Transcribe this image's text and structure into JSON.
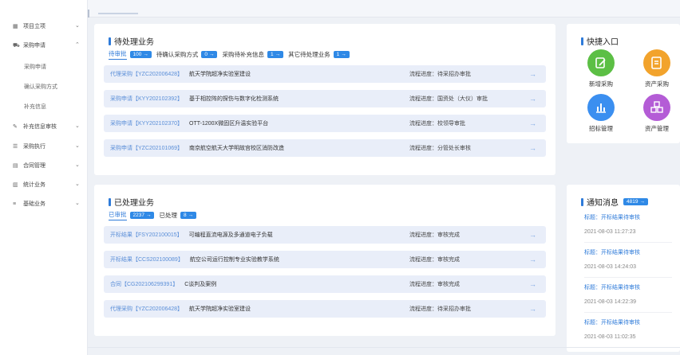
{
  "sidebar": {
    "items": [
      {
        "label": "项目立项",
        "icon": "grid-icon",
        "glyph": "▦",
        "expanded": false
      },
      {
        "label": "采购申请",
        "icon": "cart-icon",
        "glyph": "⛟",
        "expanded": true
      },
      {
        "label": "补充信息审核",
        "icon": "edit-icon",
        "glyph": "✎",
        "expanded": false
      },
      {
        "label": "采购执行",
        "icon": "list-icon",
        "glyph": "☰",
        "expanded": false
      },
      {
        "label": "合同管理",
        "icon": "document-icon",
        "glyph": "▤",
        "expanded": false
      },
      {
        "label": "统计业务",
        "icon": "chart-icon",
        "glyph": "▥",
        "expanded": false
      },
      {
        "label": "基础业务",
        "icon": "stack-icon",
        "glyph": "≡",
        "expanded": false
      }
    ],
    "submenu": [
      "采购申请",
      "确认采购方式",
      "补充信息"
    ]
  },
  "pending": {
    "title": "待处理业务",
    "tabs": [
      {
        "label": "待审批",
        "count": "100"
      },
      {
        "label": "待确认采购方式",
        "count": "0"
      },
      {
        "label": "采购待补充信息",
        "count": "1"
      },
      {
        "label": "其它待处理业务",
        "count": "1"
      }
    ],
    "rows": [
      {
        "code": "代理采购【YZC202006428】",
        "name": "航天学院超净实验室建设",
        "status": "流程进度：待采招办审批"
      },
      {
        "code": "采购申请【KYY202102392】",
        "name": "基于相控阵的探伤与数字化检测系统",
        "status": "流程进度：国资处（大仪）审批"
      },
      {
        "code": "采购申请【KYY202102370】",
        "name": "OTT-1200X微固区升温实验平台",
        "status": "流程进度：校领导审批"
      },
      {
        "code": "采购申请【YZC202101069】",
        "name": "南京航空航天大学明故宫校区消防改造",
        "status": "流程进度：分管处长审核"
      }
    ]
  },
  "done": {
    "title": "已处理业务",
    "tabs": [
      {
        "label": "已审批",
        "count": "2237"
      },
      {
        "label": "已处理",
        "count": "8"
      }
    ],
    "rows": [
      {
        "code": "开标结果【FSY202100015】",
        "name": "可编程直流电源及多通道电子负载",
        "status": "流程进度：审核完成"
      },
      {
        "code": "开标结果【CCS202100089】",
        "name": "航空公司运行控制专业实验教学系统",
        "status": "流程进度：审核完成"
      },
      {
        "code": "合同【CG202106299391】",
        "name": "C谈判及案例",
        "status": "流程进度：审核完成"
      },
      {
        "code": "代理采购【YZC202006428】",
        "name": "航天学院超净实验室建设",
        "status": "流程进度：待采招办审批"
      }
    ]
  },
  "quick": {
    "title": "快捷入口",
    "items": [
      {
        "label": "新增采购",
        "icon": "new-purchase-icon",
        "color": "#5cbf45",
        "glyph": "✎"
      },
      {
        "label": "资产采购",
        "icon": "asset-purchase-icon",
        "color": "#f2a32c",
        "glyph": "✎"
      },
      {
        "label": "招标管理",
        "icon": "tender-chart-icon",
        "color": "#3b8ff0",
        "glyph": "▮"
      },
      {
        "label": "资产管理",
        "icon": "asset-cubes-icon",
        "color": "#b45cd6",
        "glyph": "◈"
      }
    ]
  },
  "notices": {
    "title": "通知消息",
    "count": "4819",
    "items": [
      {
        "title": "标题：开标结果待审核",
        "date": "2021-08-03 11:27:23"
      },
      {
        "title": "标题：开标结果待审核",
        "date": "2021-08-03 14:24:03"
      },
      {
        "title": "标题：开标结果待审核",
        "date": "2021-08-03 14:22:39"
      },
      {
        "title": "标题：开标结果待审核",
        "date": "2021-08-03 11:02:35"
      }
    ]
  },
  "colors": {
    "accent": "#2f7bd9",
    "badge": "#2f89e6",
    "row_bg": "#e9eef9"
  }
}
